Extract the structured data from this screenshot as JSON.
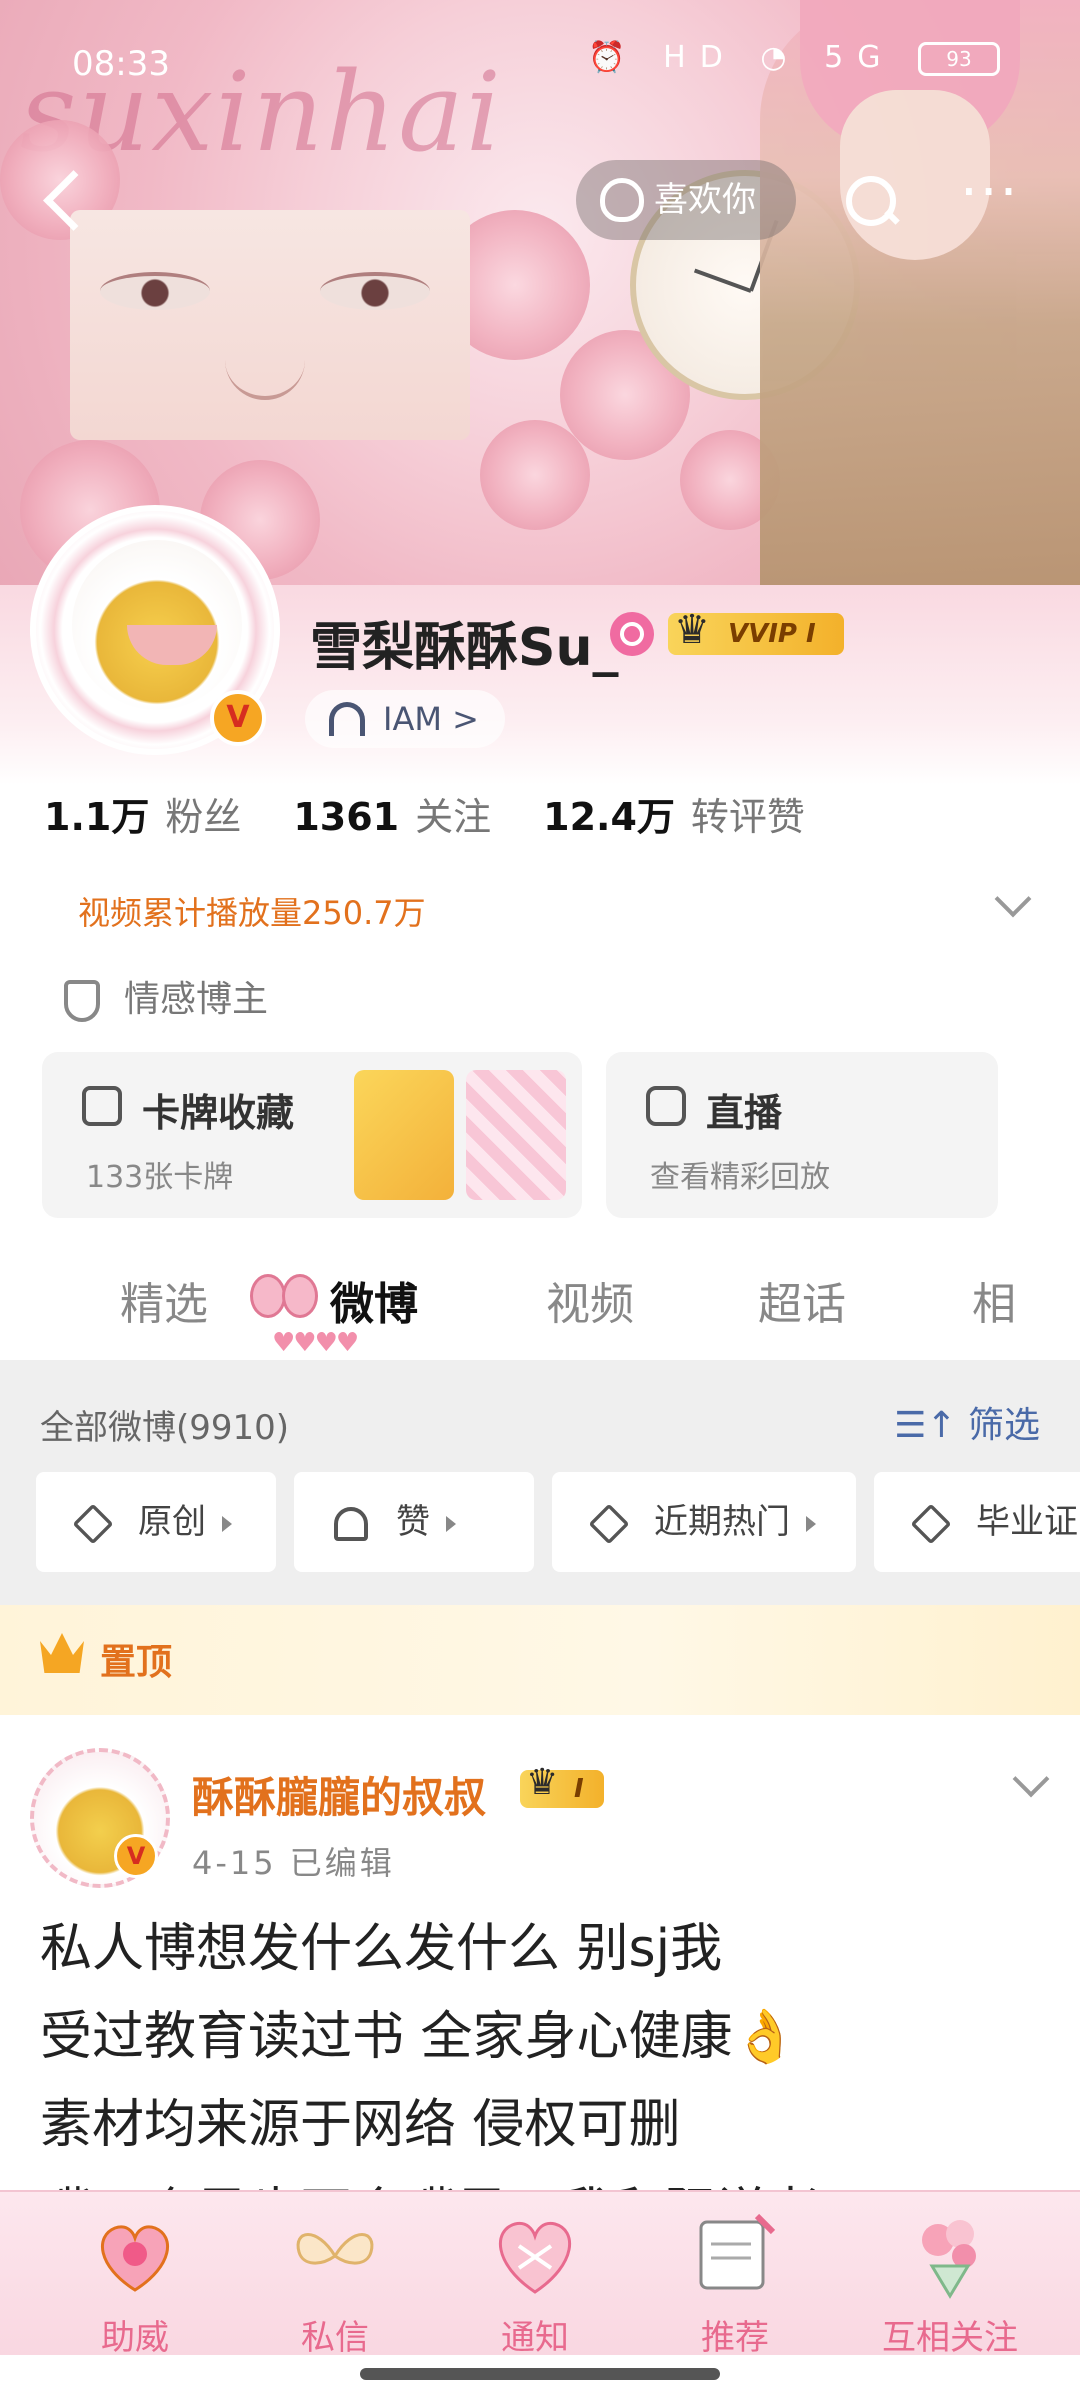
{
  "status_bar": {
    "time": "08:33",
    "battery": "93",
    "network": "5G",
    "hd": "HD"
  },
  "header": {
    "watermark": "suxinhai",
    "like_button_label": "喜欢你"
  },
  "profile": {
    "username": "雪梨酥酥Su_",
    "vvip_badge": "VVIP I",
    "verified_mark": "V",
    "music_label": "IAM >",
    "stats": [
      {
        "value": "1.1万",
        "label": "粉丝"
      },
      {
        "value": "1361",
        "label": "关注"
      },
      {
        "value": "12.4万",
        "label": "转评赞"
      }
    ],
    "play_count": "视频累计播放量250.7万",
    "tag": "情感博主"
  },
  "cards": {
    "cards_title": "卡牌收藏",
    "cards_sub": "133张卡牌",
    "live_title": "直播",
    "live_sub": "查看精彩回放"
  },
  "tabs": [
    {
      "label": "精选"
    },
    {
      "label": "微博"
    },
    {
      "label": "视频"
    },
    {
      "label": "超话"
    },
    {
      "label": "相"
    }
  ],
  "filter": {
    "all_weibo": "全部微博(9910)",
    "filter_label": "筛选",
    "chips": [
      {
        "label": "原创"
      },
      {
        "label": "赞"
      },
      {
        "label": "近期热门"
      },
      {
        "label": "毕业证"
      }
    ]
  },
  "pinned_post": {
    "pinned_label": "置顶",
    "author": "酥酥朧朧的叔叔",
    "author_badge": "I",
    "time": "4-15  已编辑",
    "lines": [
      "私人博想发什么发什么 别sj我",
      "受过教育读过书 全家身心健康👌",
      "素材均来源于网络 侵权可删",
      "嘴一个风也不会嘴风，我和阳说老"
    ]
  },
  "bottom_nav": [
    {
      "label": "助威",
      "color": "#e86a8e"
    },
    {
      "label": "私信",
      "color": "#e86a8e"
    },
    {
      "label": "通知",
      "color": "#e86a8e"
    },
    {
      "label": "推荐",
      "color": "#e86a8e"
    },
    {
      "label": "互相关注",
      "color": "#e86a8e"
    }
  ],
  "accent_colors": {
    "orange": "#e2711d",
    "pink": "#f28fab",
    "blue_link": "#4a6aa8"
  }
}
